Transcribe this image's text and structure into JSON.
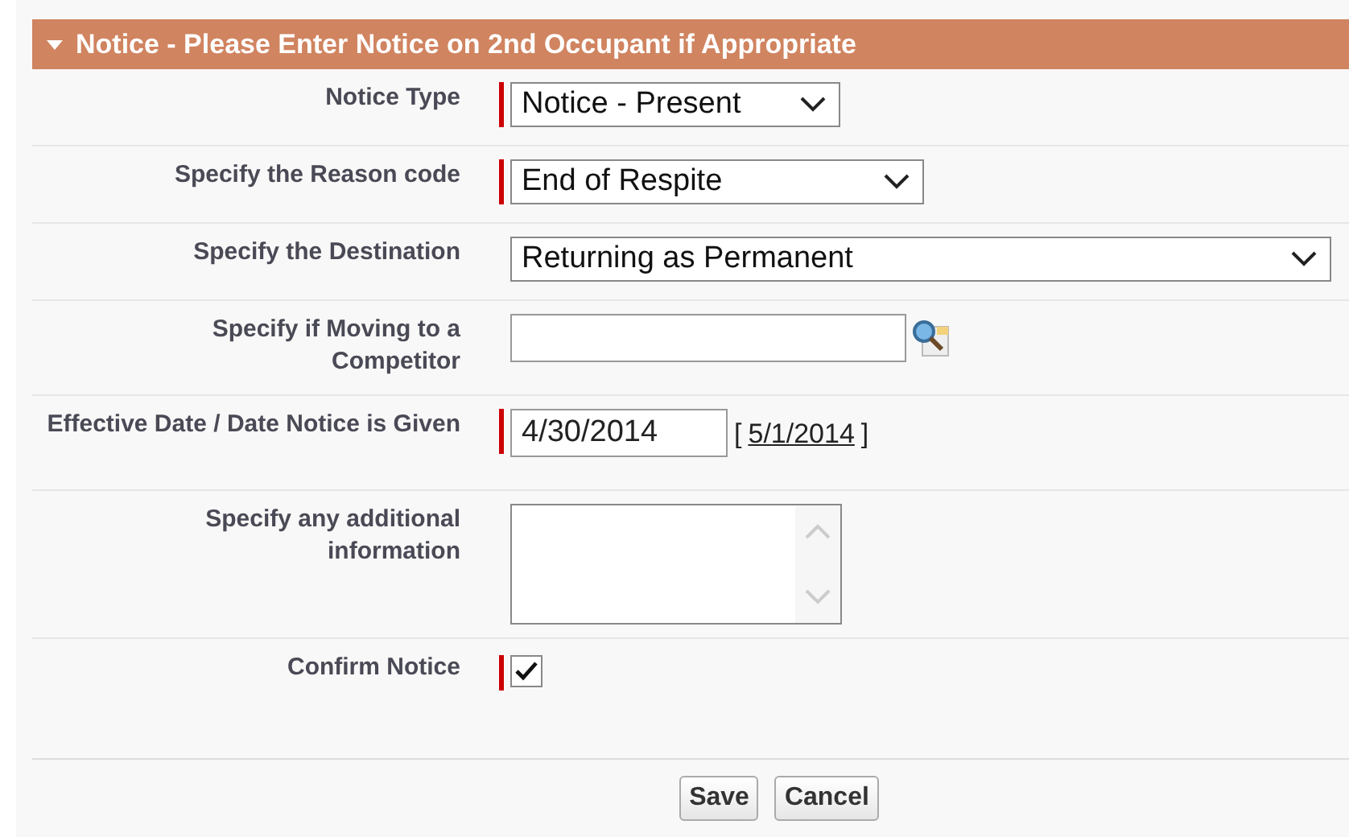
{
  "section": {
    "title": "Notice - Please Enter Notice on 2nd Occupant if Appropriate",
    "expanded": true
  },
  "fields": [
    {
      "kind": "select",
      "label": "Notice Type",
      "required": true,
      "value": "Notice - Present"
    },
    {
      "kind": "select",
      "label": "Specify the Reason code",
      "required": true,
      "value": "End of Respite"
    },
    {
      "kind": "select",
      "label": "Specify the Destination",
      "required": false,
      "value": "Returning as Permanent"
    },
    {
      "kind": "lookup",
      "label": "Specify if Moving to a Competitor",
      "required": false
    },
    {
      "kind": "date",
      "label": "Effective Date / Date Notice is Given",
      "required": true,
      "value": "4/30/2014",
      "bracket_open": "[",
      "today": "5/1/2014",
      "bracket_close": "]"
    },
    {
      "kind": "textarea",
      "label": "Specify any additional information",
      "required": false
    },
    {
      "kind": "checkbox",
      "label": "Confirm Notice",
      "required": true,
      "checked": true
    }
  ],
  "buttons": [
    "Save",
    "Cancel"
  ]
}
